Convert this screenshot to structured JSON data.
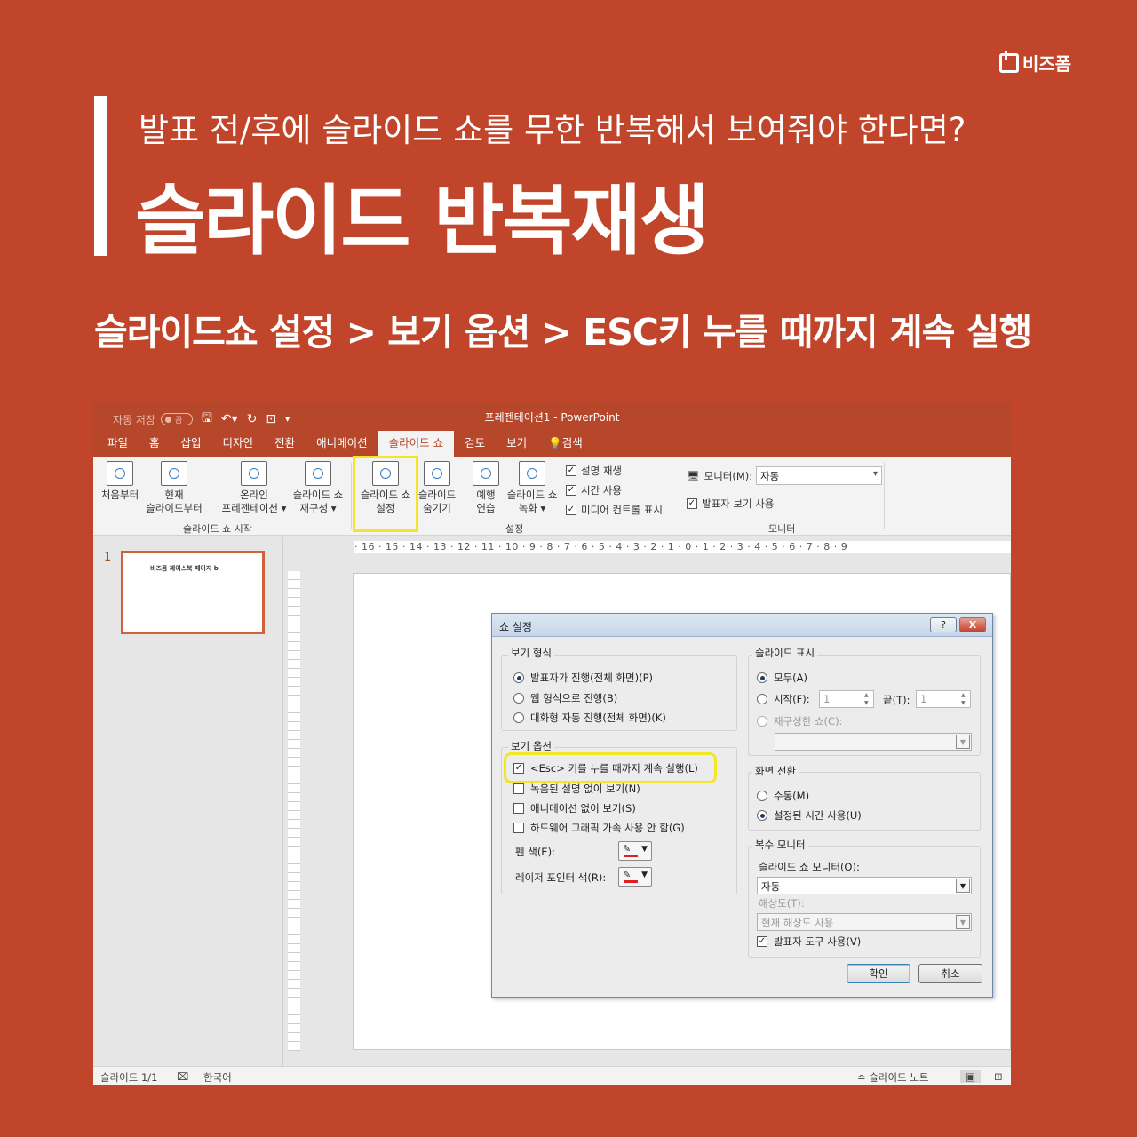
{
  "brand": {
    "name": "비즈폼"
  },
  "header": {
    "subtitle": "발표 전/후에 슬라이드 쇼를 무한 반복해서 보여줘야 한다면?",
    "title": "슬라이드 반복재생",
    "path": "슬라이드쇼 설정 > 보기 옵션 > ESC키 누를 때까지 계속 실행"
  },
  "ppt": {
    "autosave_label": "자동 저장",
    "autosave_state": "끔",
    "window_title": "프레젠테이션1  -  PowerPoint",
    "tabs": [
      "파일",
      "홈",
      "삽입",
      "디자인",
      "전환",
      "애니메이션",
      "슬라이드 쇼",
      "검토",
      "보기",
      "검색"
    ],
    "active_tab": "슬라이드 쇼",
    "ribbon": {
      "from_start": "처음부터",
      "from_current_1": "현재",
      "from_current_2": "슬라이드부터",
      "online_1": "온라인",
      "online_2": "프레젠테이션 ▾",
      "custom_1": "슬라이드 쇼",
      "custom_2": "재구성 ▾",
      "group_start": "슬라이드 쇼 시작",
      "setup_1": "슬라이드 쇼",
      "setup_2": "설정",
      "hide_1": "슬라이드",
      "hide_2": "숨기기",
      "rehearse_1": "예행",
      "rehearse_2": "연습",
      "record_1": "슬라이드 쇼",
      "record_2": "녹화 ▾",
      "chk_narration": "설명 재생",
      "chk_timing": "시간 사용",
      "chk_media": "미디어 컨트롤 표시",
      "group_setup": "설정",
      "monitor_label": "모니터(M):",
      "monitor_value": "자동",
      "presenter_view": "발표자 보기 사용",
      "group_monitor": "모니터"
    },
    "slide_number": "1",
    "thumb_text": "비즈폼 제이스북 페이지 b",
    "ruler_h": "· 16 · 15 · 14 · 13 · 12 · 11 · 10 · 9 · 8 · 7 · 6 · 5 · 4 · 3 · 2 · 1 · 0 · 1 · 2 · 3 · 4 · 5 · 6 · 7 · 8 · 9",
    "status": {
      "slide_count": "슬라이드 1/1",
      "language": "한국어",
      "notes": "슬라이드 노트"
    }
  },
  "dialog": {
    "title": "쇼 설정",
    "help": "?",
    "close": "X",
    "view_type": {
      "legend": "보기 형식",
      "opt1": "발표자가 진행(전체 화면)(P)",
      "opt2": "웹 형식으로 진행(B)",
      "opt3": "대화형 자동 진행(전체 화면)(K)"
    },
    "view_options": {
      "legend": "보기 옵션",
      "loop": "<Esc> 키를 누를 때까지 계속 실행(L)",
      "no_narration": "녹음된 설명 없이 보기(N)",
      "no_animation": "애니메이션 없이 보기(S)",
      "no_hw_accel": "하드웨어 그래픽 가속 사용 안 함(G)",
      "pen_color": "펜 색(E):",
      "laser_color": "레이저 포인터 색(R):"
    },
    "show_slides": {
      "legend": "슬라이드 표시",
      "all": "모두(A)",
      "from": "시작(F):",
      "from_value": "1",
      "to": "끝(T):",
      "to_value": "1",
      "custom": "재구성한 쇼(C):"
    },
    "advance": {
      "legend": "화면 전환",
      "manual": "수동(M)",
      "timings": "설정된 시간 사용(U)"
    },
    "multi_monitor": {
      "legend": "복수 모니터",
      "monitor_label": "슬라이드 쇼 모니터(O):",
      "monitor_value": "자동",
      "resolution_label": "해상도(T):",
      "resolution_value": "현재 해상도 사용",
      "presenter_tools": "발표자 도구 사용(V)"
    },
    "ok": "확인",
    "cancel": "취소"
  },
  "colors": {
    "background": "#c0452a",
    "ppt_accent": "#b7472a",
    "highlight": "#f1e628",
    "pen": "#e02020"
  }
}
